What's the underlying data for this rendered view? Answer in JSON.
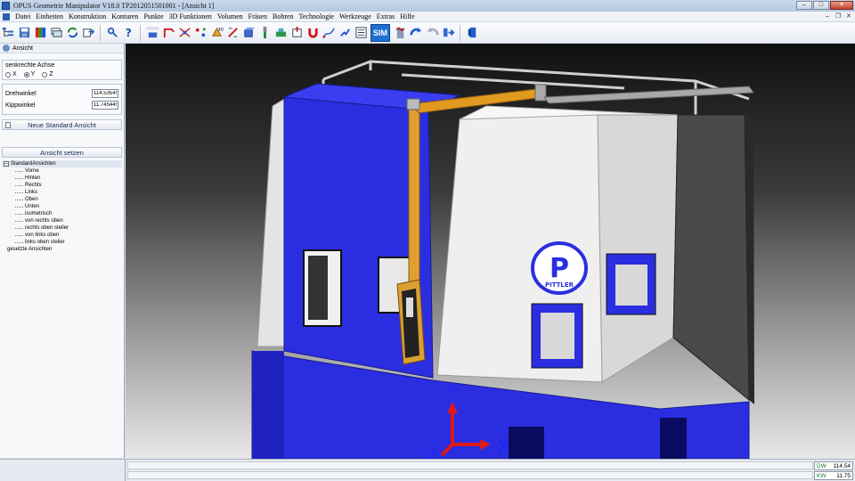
{
  "window": {
    "title": "OPUS Geometrie Manipulator V18.0   TP2012051501001   - [Ansicht 1]",
    "btn_min": "–",
    "btn_max": "□",
    "btn_close": "✕"
  },
  "menu": {
    "items": [
      "Datei",
      "Einheiten",
      "Konstruktion",
      "Konturen",
      "Punkte",
      "3D Funktionen",
      "Volumen",
      "Fräsen",
      "Bohren",
      "Technologie",
      "Werkzeuge",
      "Extras",
      "Hilfe"
    ],
    "mdi_min": "–",
    "mdi_restore": "❐",
    "mdi_close": "✕"
  },
  "toolbar": {
    "sim_label": "SIM"
  },
  "left_panel": {
    "header": "Ansicht",
    "axis_group": {
      "title": "senkrechte Achse",
      "options": [
        "X",
        "Y",
        "Z"
      ],
      "selected": "Y"
    },
    "fields": {
      "drehwinkel_label": "Drehwinkel",
      "drehwinkel_value": "114.53549",
      "kippwinkel_label": "Kippwinkel",
      "kippwinkel_value": "11.745449"
    },
    "new_standard_view": "Neue Standard Ansicht",
    "set_view": "Ansicht setzen",
    "tree": {
      "root": "StandardAnsichten",
      "items": [
        "Vorne",
        "Hinten",
        "Rechts",
        "Links",
        "Oben",
        "Unten",
        "isometrisch",
        "von rechts oben",
        "rechts oben steiler",
        "von links oben",
        "links oben steiler"
      ],
      "second_root": "gesetzte Ansichten"
    }
  },
  "viewport": {
    "axis_x": "X",
    "axis_y": "Y",
    "axis_z": "Z",
    "logo_letter": "P",
    "logo_text": "PITTLER",
    "colors": {
      "machine_blue": "#2a2ee0",
      "panel_white": "#ececec",
      "arm_orange": "#e09a20",
      "axis_red": "#e01818",
      "axis_blue": "#2020ff"
    }
  },
  "status": {
    "dw_label": "DW",
    "dw_value": "114.54",
    "kw_label": "KW",
    "kw_value": "11.75"
  }
}
